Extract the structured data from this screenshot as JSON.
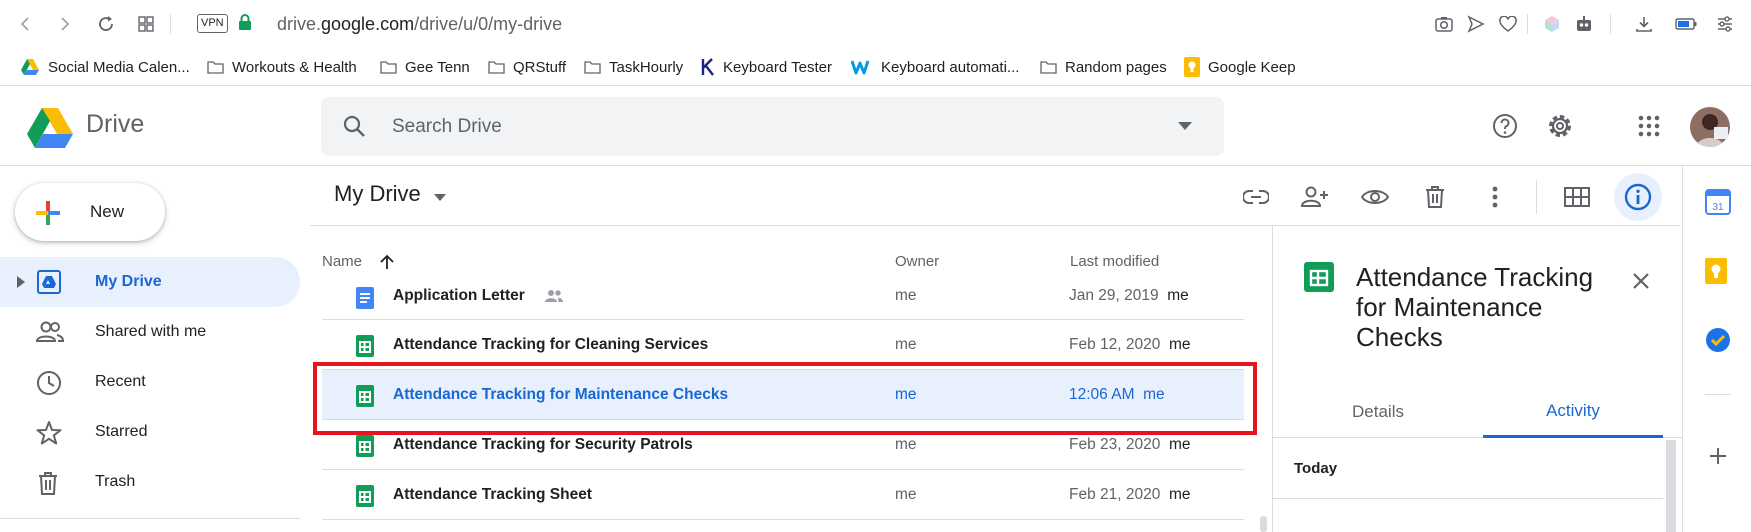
{
  "browser": {
    "url_prefix": "drive.",
    "url_domain": "google.com",
    "url_path": "/drive/u/0/my-drive",
    "vpn_label": "VPN"
  },
  "bookmarks": [
    {
      "label": "Social Media Calen..."
    },
    {
      "label": "Workouts & Health"
    },
    {
      "label": "Gee Tenn"
    },
    {
      "label": "QRStuff"
    },
    {
      "label": "TaskHourly"
    },
    {
      "label": "Keyboard Tester"
    },
    {
      "label": "Keyboard automati..."
    },
    {
      "label": "Random pages"
    },
    {
      "label": "Google Keep"
    }
  ],
  "header": {
    "app_name": "Drive",
    "search_placeholder": "Search Drive"
  },
  "sidebar": {
    "new_label": "New",
    "items": [
      {
        "label": "My Drive",
        "active": true
      },
      {
        "label": "Shared with me"
      },
      {
        "label": "Recent"
      },
      {
        "label": "Starred"
      },
      {
        "label": "Trash"
      }
    ]
  },
  "main": {
    "title": "My Drive",
    "columns": {
      "name": "Name",
      "owner": "Owner",
      "modified": "Last modified"
    },
    "rows": [
      {
        "name": "Application Letter",
        "owner": "me",
        "date": "Jan 29, 2019",
        "by": "me",
        "type": "doc",
        "shared": true
      },
      {
        "name": "Attendance Tracking for Cleaning Services",
        "owner": "me",
        "date": "Feb 12, 2020",
        "by": "me",
        "type": "sheet"
      },
      {
        "name": "Attendance Tracking for Maintenance Checks",
        "owner": "me",
        "date": "12:06 AM",
        "by": "me",
        "type": "sheet",
        "selected": true
      },
      {
        "name": "Attendance Tracking for Security Patrols",
        "owner": "me",
        "date": "Feb 23, 2020",
        "by": "me",
        "type": "sheet"
      },
      {
        "name": "Attendance Tracking Sheet",
        "owner": "me",
        "date": "Feb 21, 2020",
        "by": "me",
        "type": "sheet"
      }
    ]
  },
  "detail": {
    "title": "Attendance Tracking for Maintenance Checks",
    "tabs": [
      {
        "label": "Details"
      },
      {
        "label": "Activity",
        "active": true
      }
    ],
    "section": "Today"
  },
  "colors": {
    "accent": "#1967d2",
    "highlight_box": "#e4151f",
    "sheets_green": "#0f9d58",
    "docs_blue": "#4285f4"
  }
}
